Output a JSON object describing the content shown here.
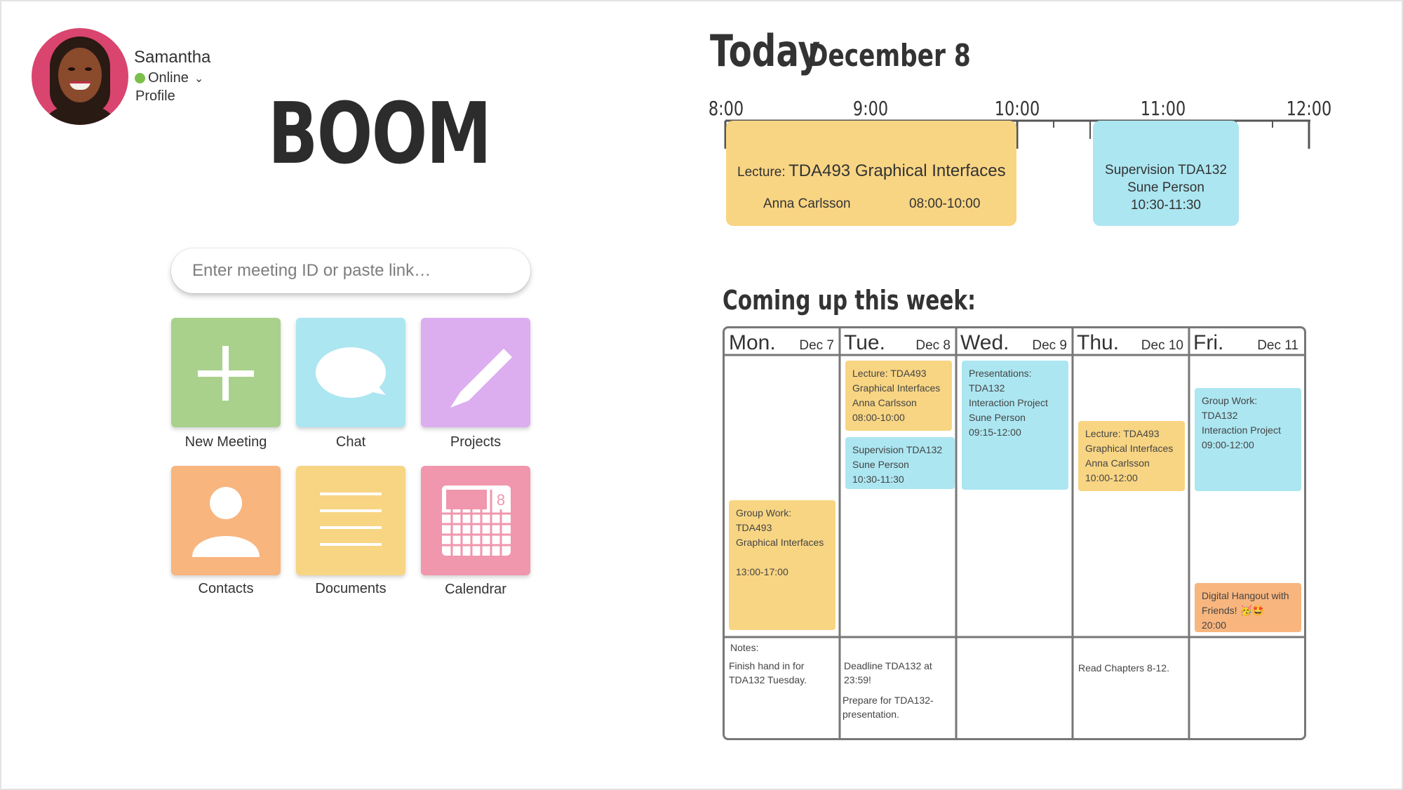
{
  "profile": {
    "name": "Samantha",
    "status": "Online",
    "profile_link": "Profile"
  },
  "app": {
    "logo": "BOOM"
  },
  "search": {
    "placeholder": "Enter meeting ID or paste link…"
  },
  "tiles": [
    {
      "label": "New Meeting",
      "icon": "plus-icon",
      "color": "#a9d18c"
    },
    {
      "label": "Chat",
      "icon": "chat-bubble-icon",
      "color": "#ace6f1"
    },
    {
      "label": "Projects",
      "icon": "pencil-icon",
      "color": "#dcaef0"
    },
    {
      "label": "Contacts",
      "icon": "person-icon",
      "color": "#f8b57e"
    },
    {
      "label": "Documents",
      "icon": "document-lines-icon",
      "color": "#f8d583"
    },
    {
      "label": "Calendrar",
      "icon": "calendar-icon",
      "color": "#f096ad",
      "calendar_day": "8"
    }
  ],
  "today": {
    "title": "Today",
    "date": "December 8",
    "hours": [
      "8:00",
      "9:00",
      "10:00",
      "11:00",
      "12:00"
    ],
    "events": [
      {
        "prefix": "Lecture:",
        "title": "TDA493 Graphical Interfaces",
        "person": "Anna Carlsson",
        "time": "08:00-10:00",
        "color": "#f8d583"
      },
      {
        "title": "Supervision TDA132",
        "person": "Sune Person",
        "time": "10:30-11:30",
        "color": "#ace6f1"
      }
    ]
  },
  "week": {
    "heading": "Coming up this week:",
    "days": [
      {
        "name": "Mon.",
        "date": "Dec 7"
      },
      {
        "name": "Tue.",
        "date": "Dec 8"
      },
      {
        "name": "Wed.",
        "date": "Dec 9"
      },
      {
        "name": "Thu.",
        "date": "Dec 10"
      },
      {
        "name": "Fri.",
        "date": "Dec 11"
      }
    ],
    "events": {
      "mon_group": "Group Work: TDA493\nGraphical Interfaces\n\n13:00-17:00",
      "tue_lecture": "Lecture: TDA493\nGraphical Interfaces\nAnna Carlsson\n08:00-10:00",
      "tue_supervision": "Supervision TDA132\nSune Person\n10:30-11:30",
      "wed_presentations": "Presentations:\nTDA132\nInteraction Project\nSune Person\n09:15-12:00",
      "thu_lecture": "Lecture: TDA493\nGraphical Interfaces\nAnna Carlsson\n10:00-12:00",
      "fri_group": "Group Work: TDA132\nInteraction Project\n09:00-12:00",
      "fri_hangout": "Digital Hangout with\nFriends! 🥳🤩\n20:00"
    },
    "notes_label": "Notes:",
    "notes": {
      "mon": "Finish hand in for\nTDA132 Tuesday.",
      "tue_1": "Deadline TDA132 at\n23:59!",
      "tue_2": "Prepare for TDA132-\npresentation.",
      "thu": "Read Chapters 8-12."
    }
  }
}
